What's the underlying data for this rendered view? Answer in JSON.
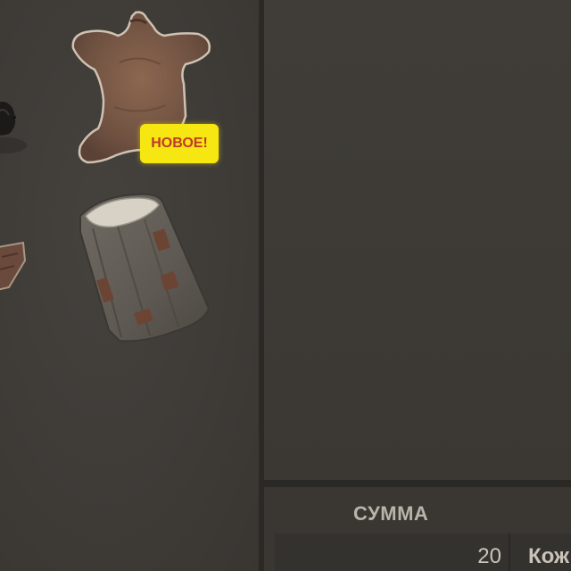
{
  "inventory": {
    "items": [
      {
        "icon": "cooking-pot-icon"
      },
      {
        "icon": "bear-pelt-icon",
        "badge": "НОВОЕ!"
      },
      {
        "icon": "leather-scrap-icon"
      },
      {
        "icon": "sleeping-bag-icon"
      }
    ]
  },
  "summary": {
    "header": "СУММА",
    "rows": [
      {
        "qty": "20",
        "name": "Кож"
      }
    ]
  },
  "colors": {
    "badge_bg": "#f6e611",
    "badge_text": "#c0392b",
    "panel_bg": "#3d3a36"
  }
}
